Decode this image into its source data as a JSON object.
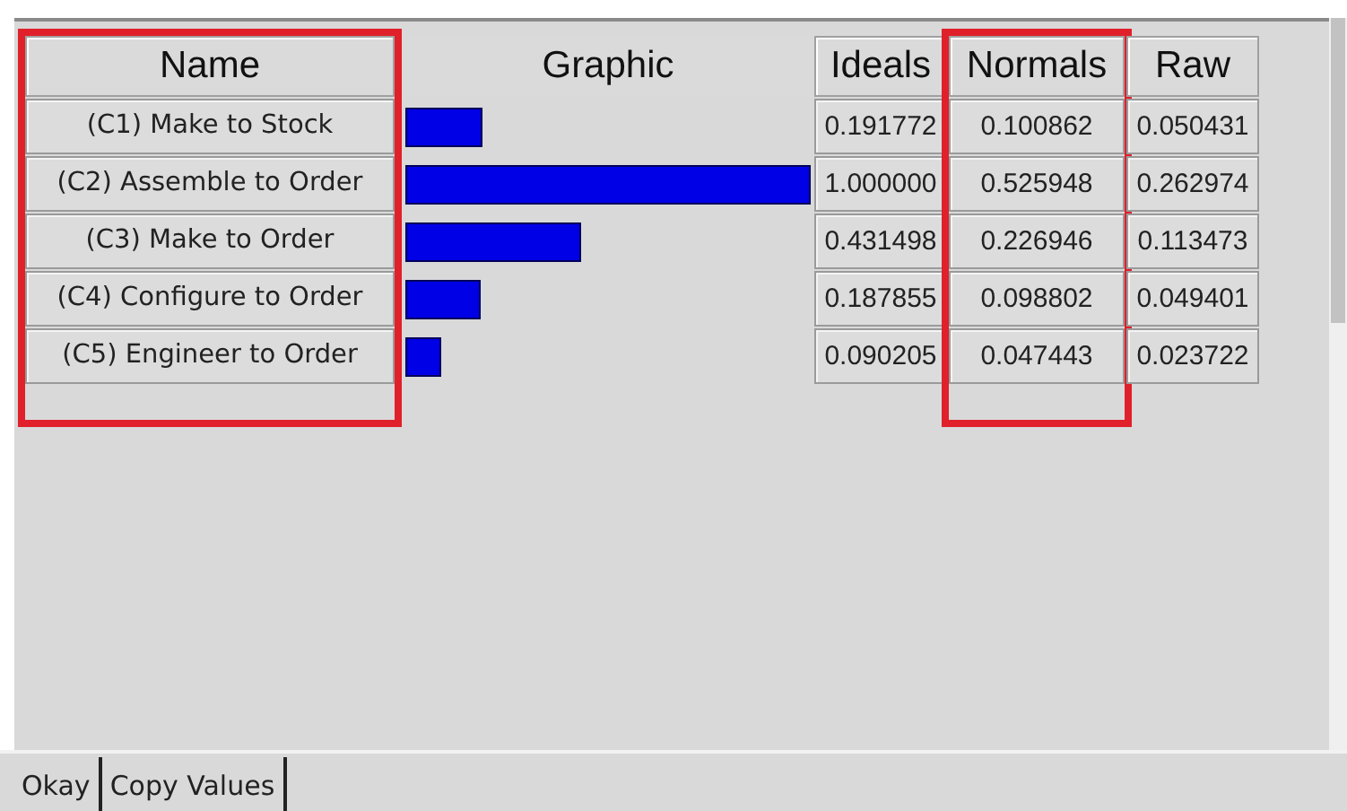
{
  "columns": [
    {
      "title": "Name",
      "kind": "name",
      "highlighted": true
    },
    {
      "title": "Graphic",
      "kind": "graphic",
      "highlighted": false
    },
    {
      "title": "Ideals",
      "kind": "number",
      "highlighted": false
    },
    {
      "title": "Normals",
      "kind": "number",
      "highlighted": true
    },
    {
      "title": "Raw",
      "kind": "number",
      "highlighted": false
    }
  ],
  "rows": [
    {
      "name": "(C1) Make to Stock",
      "values": [
        "0.191772",
        "0.100862",
        "0.050431"
      ]
    },
    {
      "name": "(C2) Assemble to Order",
      "values": [
        "1.000000",
        "0.525948",
        "0.262974"
      ]
    },
    {
      "name": "(C3) Make to Order",
      "values": [
        "0.431498",
        "0.226946",
        "0.113473"
      ]
    },
    {
      "name": "(C4) Configure to Order",
      "values": [
        "0.187855",
        "0.098802",
        "0.049401"
      ]
    },
    {
      "name": "(C5) Engineer to Order",
      "values": [
        "0.090205",
        "0.047443",
        "0.023722"
      ]
    }
  ],
  "buttons": [
    "Okay",
    "Copy Values"
  ]
}
